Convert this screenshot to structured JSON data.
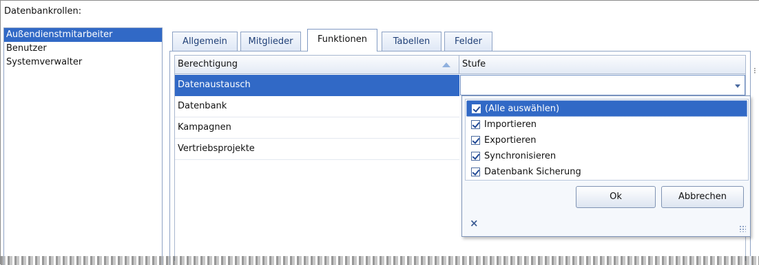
{
  "panel": {
    "roles_label": "Datenbankrollen:"
  },
  "roles": [
    {
      "label": "Außendienstmitarbeiter",
      "selected": true
    },
    {
      "label": "Benutzer",
      "selected": false
    },
    {
      "label": "Systemverwalter",
      "selected": false
    }
  ],
  "tabs": [
    {
      "label": "Allgemein",
      "active": false
    },
    {
      "label": "Mitglieder",
      "active": false
    },
    {
      "label": "Funktionen",
      "active": true
    },
    {
      "label": "Tabellen",
      "active": false
    },
    {
      "label": "Felder",
      "active": false
    }
  ],
  "grid": {
    "columns": [
      "Berechtigung",
      "Stufe"
    ],
    "rows": [
      {
        "berechtigung": "Datenaustausch",
        "selected": true
      },
      {
        "berechtigung": "Datenbank",
        "selected": false
      },
      {
        "berechtigung": "Kampagnen",
        "selected": false
      },
      {
        "berechtigung": "Vertriebsprojekte",
        "selected": false
      }
    ]
  },
  "dropdown": {
    "items": [
      {
        "label": "(Alle auswählen)",
        "checked": true,
        "highlighted": true
      },
      {
        "label": "Importieren",
        "checked": true,
        "highlighted": false
      },
      {
        "label": "Exportieren",
        "checked": true,
        "highlighted": false
      },
      {
        "label": "Synchronisieren",
        "checked": true,
        "highlighted": false
      },
      {
        "label": "Datenbank Sicherung",
        "checked": true,
        "highlighted": false
      }
    ],
    "ok_label": "Ok",
    "cancel_label": "Abbrechen",
    "close_glyph": "×",
    "scroll_glyph": "⁝"
  },
  "colors": {
    "selection": "#3169c6",
    "border": "#8da2c4"
  },
  "icons": {
    "sort": "sort-ascending-icon",
    "combo": "dropdown-arrow-icon",
    "checkbox": "checkbox-checked-icon",
    "close": "close-icon",
    "grip": "resize-grip-icon"
  }
}
